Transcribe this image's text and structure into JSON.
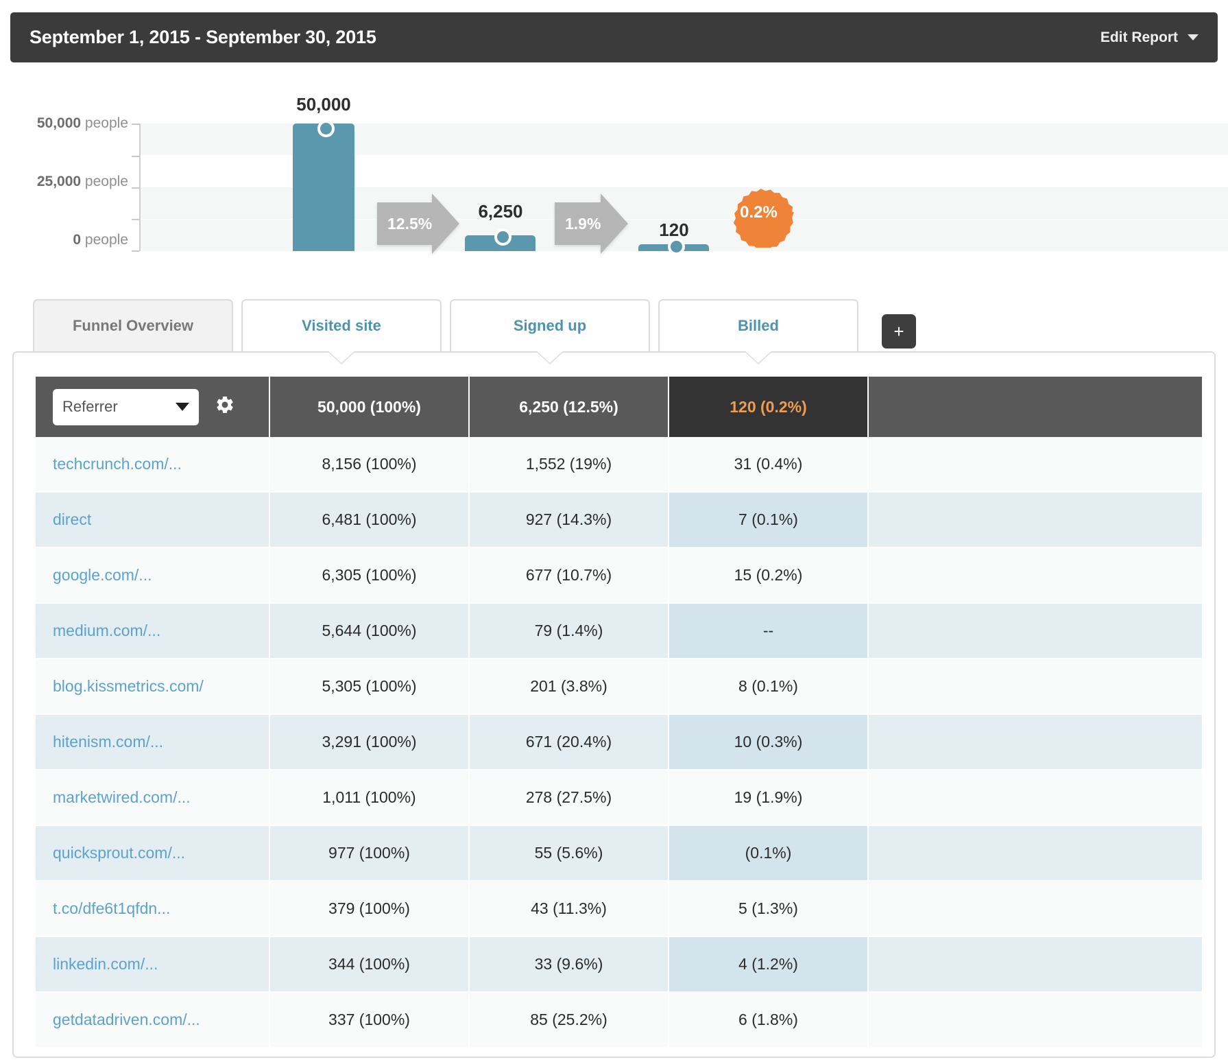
{
  "header": {
    "date_range": "September 1, 2015 - September 30, 2015",
    "edit_report_label": "Edit Report"
  },
  "chart_data": {
    "type": "bar",
    "title": "",
    "xlabel": "",
    "ylabel": "people",
    "ylim": [
      0,
      50000
    ],
    "grid": true,
    "categories": [
      "Visited site",
      "Signed up",
      "Billed"
    ],
    "values": [
      50000,
      6250,
      120
    ],
    "value_labels": [
      "50,000",
      "6,250",
      "120"
    ],
    "tick_labels": [
      "50,000 people",
      "25,000 people",
      "0 people"
    ],
    "tick_values": [
      50000,
      25000,
      0
    ],
    "conversion_arrows": [
      "12.5%",
      "1.9%"
    ],
    "overall_badge": "0.2%",
    "bar_color": "#5b98ae",
    "arrow_color": "#b6b6b6",
    "badge_color": "#ef8337"
  },
  "tabs": [
    {
      "label": "Funnel Overview",
      "active": false,
      "style": "overview"
    },
    {
      "label": "Visited site",
      "active": true,
      "style": "step"
    },
    {
      "label": "Signed up",
      "active": true,
      "style": "step"
    },
    {
      "label": "Billed",
      "active": true,
      "style": "step"
    }
  ],
  "add_tab_label": "+",
  "table": {
    "dimension_selected": "Referrer",
    "headers": [
      "50,000 (100%)",
      "6,250 (12.5%)",
      "120 (0.2%)",
      ""
    ],
    "active_header_index": 2,
    "rows": [
      {
        "dimension": "techcrunch.com/...",
        "visited": "8,156 (100%)",
        "signed_up": "1,552 (19%)",
        "billed": "31 (0.4%)",
        "extra": ""
      },
      {
        "dimension": "direct",
        "visited": "6,481 (100%)",
        "signed_up": "927 (14.3%)",
        "billed": "7 (0.1%)",
        "extra": ""
      },
      {
        "dimension": "google.com/...",
        "visited": "6,305 (100%)",
        "signed_up": "677 (10.7%)",
        "billed": "15 (0.2%)",
        "extra": ""
      },
      {
        "dimension": "medium.com/...",
        "visited": "5,644 (100%)",
        "signed_up": "79 (1.4%)",
        "billed": "--",
        "extra": ""
      },
      {
        "dimension": "blog.kissmetrics.com/",
        "visited": "5,305 (100%)",
        "signed_up": "201 (3.8%)",
        "billed": "8 (0.1%)",
        "extra": ""
      },
      {
        "dimension": "hitenism.com/...",
        "visited": "3,291 (100%)",
        "signed_up": "671 (20.4%)",
        "billed": "10 (0.3%)",
        "extra": ""
      },
      {
        "dimension": "marketwired.com/...",
        "visited": "1,011 (100%)",
        "signed_up": "278 (27.5%)",
        "billed": "19 (1.9%)",
        "extra": ""
      },
      {
        "dimension": "quicksprout.com/...",
        "visited": "977 (100%)",
        "signed_up": "55 (5.6%)",
        "billed": "(0.1%)",
        "extra": ""
      },
      {
        "dimension": "t.co/dfe6t1qfdn...",
        "visited": "379 (100%)",
        "signed_up": "43 (11.3%)",
        "billed": "5 (1.3%)",
        "extra": ""
      },
      {
        "dimension": "linkedin.com/...",
        "visited": "344 (100%)",
        "signed_up": "33 (9.6%)",
        "billed": "4 (1.2%)",
        "extra": ""
      },
      {
        "dimension": "getdatadriven.com/...",
        "visited": "337 (100%)",
        "signed_up": "85 (25.2%)",
        "billed": "6 (1.8%)",
        "extra": ""
      }
    ]
  }
}
